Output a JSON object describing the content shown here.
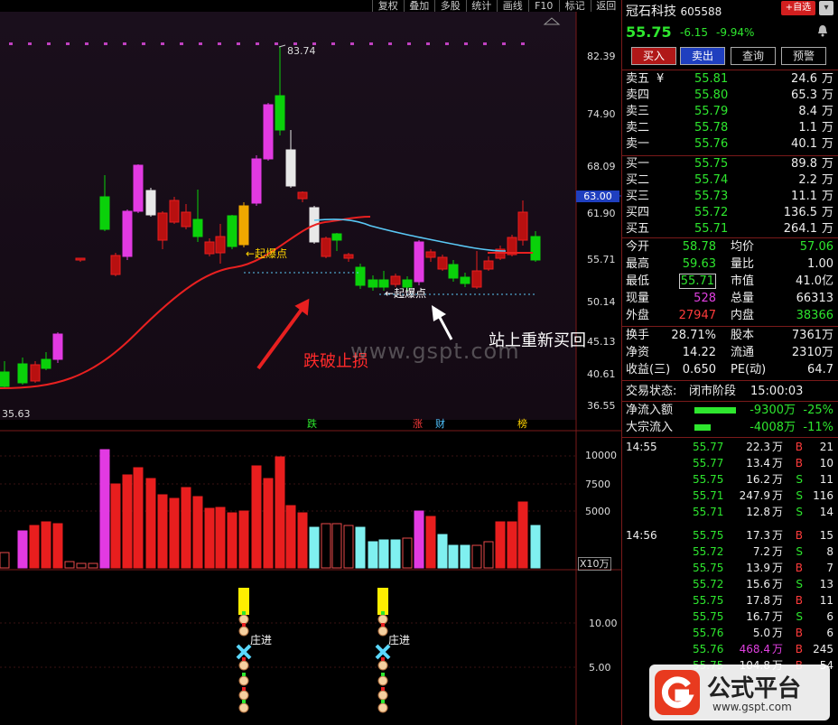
{
  "toolbar": [
    "复权",
    "叠加",
    "多股",
    "统计",
    "画线",
    "F10",
    "标记",
    "返回"
  ],
  "stock": {
    "name": "冠石科技",
    "code": "605588",
    "price": "55.75",
    "change": "-6.15",
    "change_pct": "-9.94%",
    "add_fav": "+自选",
    "dropdown": "▾"
  },
  "actions": [
    "买入",
    "卖出",
    "查询",
    "预警"
  ],
  "asks": [
    {
      "label": "卖五",
      "mark": "¥",
      "price": "55.81",
      "vol": "24.6",
      "unit": "万"
    },
    {
      "label": "卖四",
      "mark": "",
      "price": "55.80",
      "vol": "65.3",
      "unit": "万"
    },
    {
      "label": "卖三",
      "mark": "",
      "price": "55.79",
      "vol": "8.4",
      "unit": "万"
    },
    {
      "label": "卖二",
      "mark": "",
      "price": "55.78",
      "vol": "1.1",
      "unit": "万"
    },
    {
      "label": "卖一",
      "mark": "",
      "price": "55.76",
      "vol": "40.1",
      "unit": "万"
    }
  ],
  "bids": [
    {
      "label": "买一",
      "price": "55.75",
      "vol": "89.8",
      "unit": "万"
    },
    {
      "label": "买二",
      "price": "55.74",
      "vol": "2.2",
      "unit": "万"
    },
    {
      "label": "买三",
      "price": "55.73",
      "vol": "11.1",
      "unit": "万"
    },
    {
      "label": "买四",
      "price": "55.72",
      "vol": "136.5",
      "unit": "万"
    },
    {
      "label": "买五",
      "price": "55.71",
      "vol": "264.1",
      "unit": "万"
    }
  ],
  "stats": [
    {
      "l1": "今开",
      "v1": "58.78",
      "c1": "green",
      "l2": "均价",
      "v2": "57.06",
      "c2": "green"
    },
    {
      "l1": "最高",
      "v1": "59.63",
      "c1": "green",
      "l2": "量比",
      "v2": "1.00",
      "c2": "white"
    },
    {
      "l1": "最低",
      "v1": "55.71",
      "c1": "green",
      "l2": "市值",
      "v2": "41.0亿",
      "c2": "white"
    },
    {
      "l1": "现量",
      "v1": "528",
      "c1": "mag",
      "l2": "总量",
      "v2": "66313",
      "c2": "white"
    },
    {
      "l1": "外盘",
      "v1": "27947",
      "c1": "red",
      "l2": "内盘",
      "v2": "38366",
      "c2": "green"
    }
  ],
  "stats2": [
    {
      "l1": "换手",
      "v1": "28.71%",
      "l2": "股本",
      "v2": "7361万"
    },
    {
      "l1": "净资",
      "v1": "14.22",
      "l2": "流通",
      "v2": "2310万"
    },
    {
      "l1": "收益(三)",
      "v1": "0.650",
      "l2": "PE(动)",
      "v2": "64.7"
    }
  ],
  "trade_status": {
    "label": "交易状态:",
    "value": "闭市阶段",
    "time": "15:00:03"
  },
  "flows": [
    {
      "label": "净流入额",
      "value": "-9300万",
      "pct": "-25%",
      "bar": 0.72
    },
    {
      "label": "大宗流入",
      "value": "-4008万",
      "pct": "-11%",
      "bar": 0.28
    }
  ],
  "ticks": [
    {
      "time": "14:55",
      "price": "55.77",
      "vol": "22.3",
      "unit": "万",
      "side": "B",
      "n": "21"
    },
    {
      "time": "",
      "price": "55.77",
      "vol": "13.4",
      "unit": "万",
      "side": "B",
      "n": "10"
    },
    {
      "time": "",
      "price": "55.75",
      "vol": "16.2",
      "unit": "万",
      "side": "S",
      "n": "11"
    },
    {
      "time": "",
      "price": "55.71",
      "vol": "247.9",
      "unit": "万",
      "side": "S",
      "n": "116"
    },
    {
      "time": "",
      "price": "55.71",
      "vol": "12.8",
      "unit": "万",
      "side": "S",
      "n": "14"
    },
    {
      "time": "14:56",
      "price": "55.75",
      "vol": "17.3",
      "unit": "万",
      "side": "B",
      "n": "15"
    },
    {
      "time": "",
      "price": "55.72",
      "vol": "7.2",
      "unit": "万",
      "side": "S",
      "n": "8"
    },
    {
      "time": "",
      "price": "55.75",
      "vol": "13.9",
      "unit": "万",
      "side": "B",
      "n": "7"
    },
    {
      "time": "",
      "price": "55.72",
      "vol": "15.6",
      "unit": "万",
      "side": "S",
      "n": "13"
    },
    {
      "time": "",
      "price": "55.75",
      "vol": "17.8",
      "unit": "万",
      "side": "B",
      "n": "11"
    },
    {
      "time": "",
      "price": "55.75",
      "vol": "16.7",
      "unit": "万",
      "side": "S",
      "n": "6"
    },
    {
      "time": "",
      "price": "55.76",
      "vol": "5.0",
      "unit": "万",
      "side": "B",
      "n": "6"
    },
    {
      "time": "",
      "price": "55.76",
      "vol": "468.4",
      "unit": "万",
      "side": "B",
      "n": "245",
      "hl": true
    },
    {
      "time": "",
      "price": "55.75",
      "vol": "104.8",
      "unit": "万",
      "side": "B",
      "n": "54"
    }
  ],
  "chart": {
    "price_axis": [
      "82.39",
      "74.90",
      "68.09",
      "61.90",
      "55.71",
      "50.14",
      "45.13",
      "40.61",
      "36.55"
    ],
    "crosshair_price": "63.00",
    "high_label": "83.74",
    "low_label": "35.63",
    "vol_axis": [
      "10000",
      "7500",
      "5000"
    ],
    "vol_unit": "X10万",
    "ind_axis": [
      "10.00",
      "5.00"
    ],
    "baozhang1": "起爆点",
    "baozhang2": "起爆点",
    "annot_break": "跌破止损",
    "annot_rebuy": "站上重新买回",
    "watermark": "www.gspt.com",
    "markers": [
      "跌",
      "涨",
      "财",
      "榜"
    ],
    "zhuangjin": "庄进",
    "brand": "公式平台",
    "brand_url": "www.gspt.com"
  }
}
